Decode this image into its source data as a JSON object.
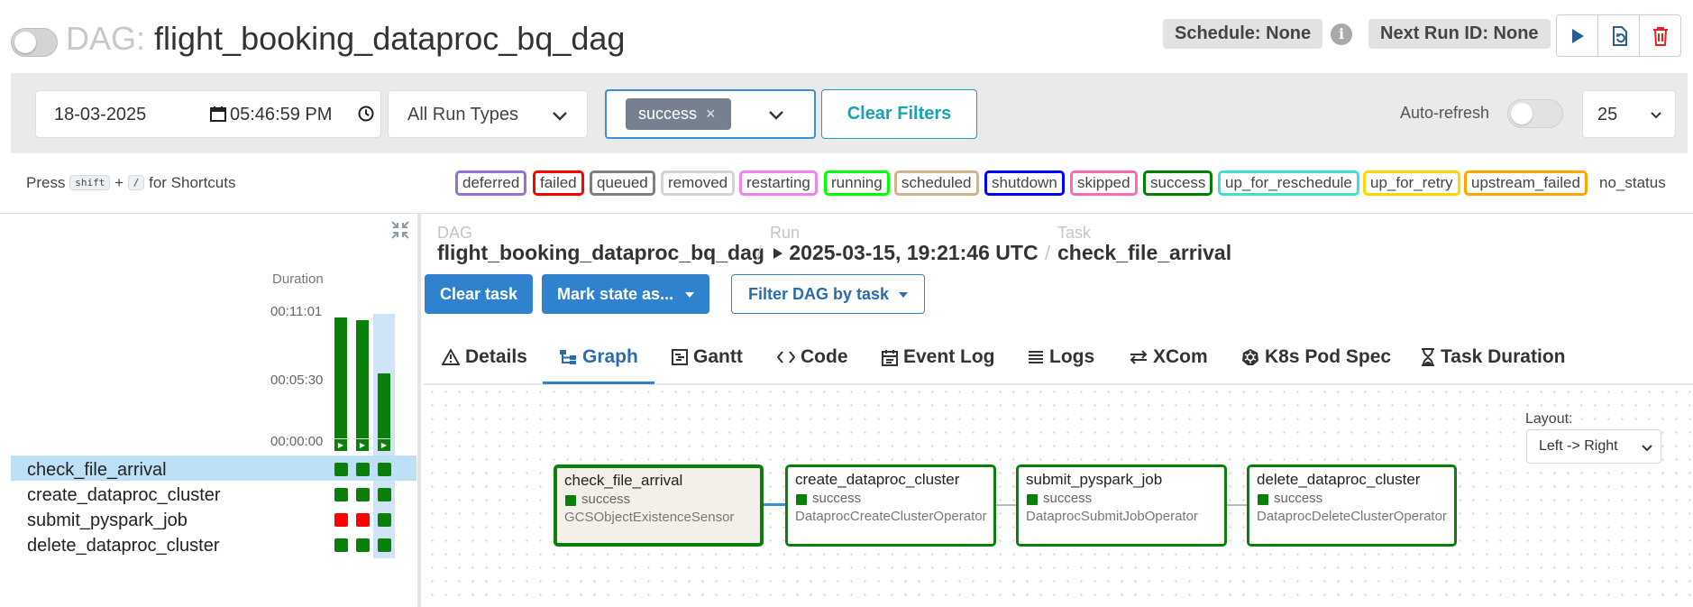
{
  "header": {
    "dag_prefix": "DAG:",
    "dag_id": "flight_booking_dataproc_bq_dag",
    "schedule": "Schedule: None",
    "info": "i",
    "next_run": "Next Run ID: None"
  },
  "filters": {
    "date": "18-03-2025",
    "time": "05:46:59 PM",
    "run_types": "All Run Types",
    "state_tag": "success",
    "state_tag_remove": "×",
    "clear_filters": "Clear Filters",
    "auto_refresh": "Auto-refresh",
    "limit": "25"
  },
  "shortcuts": {
    "press": "Press",
    "key1": "shift",
    "plus": "+",
    "key2": "/",
    "suffix": "for Shortcuts"
  },
  "legend": {
    "items": [
      {
        "label": "deferred",
        "color": "#9370db"
      },
      {
        "label": "failed",
        "color": "#ff0000"
      },
      {
        "label": "queued",
        "color": "#808080"
      },
      {
        "label": "removed",
        "color": "#d3d3d3"
      },
      {
        "label": "restarting",
        "color": "#ee82ee"
      },
      {
        "label": "running",
        "color": "#00ff00"
      },
      {
        "label": "scheduled",
        "color": "#d2b48c"
      },
      {
        "label": "shutdown",
        "color": "#0000ff"
      },
      {
        "label": "skipped",
        "color": "#ff69b4"
      },
      {
        "label": "success",
        "color": "#008000"
      },
      {
        "label": "up_for_reschedule",
        "color": "#40e0d0"
      },
      {
        "label": "up_for_retry",
        "color": "#ffd700"
      },
      {
        "label": "upstream_failed",
        "color": "#ffa500"
      }
    ],
    "no_status": "no_status"
  },
  "grid": {
    "duration_label": "Duration",
    "ticks": [
      "00:11:01",
      "00:05:30",
      "00:00:00"
    ],
    "run_durations_fraction": [
      0.97,
      0.95,
      0.52
    ],
    "tasks": [
      {
        "name": "check_file_arrival",
        "states": [
          "success",
          "success",
          "success"
        ]
      },
      {
        "name": "create_dataproc_cluster",
        "states": [
          "success",
          "success",
          "success"
        ]
      },
      {
        "name": "submit_pyspark_job",
        "states": [
          "failed",
          "failed",
          "success"
        ]
      },
      {
        "name": "delete_dataproc_cluster",
        "states": [
          "success",
          "success",
          "success"
        ]
      }
    ],
    "state_colors": {
      "success": "#0a800a",
      "failed": "#ff0000"
    }
  },
  "breadcrumb": {
    "dag_label": "DAG",
    "dag_value": "flight_booking_dataproc_bq_dag",
    "run_label": "Run",
    "run_value": "2025-03-15, 19:21:46 UTC",
    "task_label": "Task",
    "task_value": "check_file_arrival",
    "sep": "/"
  },
  "actions": {
    "clear_task": "Clear task",
    "mark_state": "Mark state as...",
    "filter_dag": "Filter DAG by task"
  },
  "tabs": [
    {
      "label": "Details",
      "icon": "warning-icon"
    },
    {
      "label": "Graph",
      "icon": "graph-icon"
    },
    {
      "label": "Gantt",
      "icon": "gantt-icon"
    },
    {
      "label": "Code",
      "icon": "code-icon"
    },
    {
      "label": "Event Log",
      "icon": "calendar-icon"
    },
    {
      "label": "Logs",
      "icon": "list-icon"
    },
    {
      "label": "XCom",
      "icon": "arrows-icon"
    },
    {
      "label": "K8s Pod Spec",
      "icon": "kubernetes-icon"
    },
    {
      "label": "Task Duration",
      "icon": "hourglass-icon"
    }
  ],
  "graph": {
    "layout_label": "Layout:",
    "layout_value": "Left -> Right",
    "nodes": [
      {
        "name": "check_file_arrival",
        "state": "success",
        "operator": "GCSObjectExistenceSensor"
      },
      {
        "name": "create_dataproc_cluster",
        "state": "success",
        "operator": "DataprocCreateClusterOperator"
      },
      {
        "name": "submit_pyspark_job",
        "state": "success",
        "operator": "DataprocSubmitJobOperator"
      },
      {
        "name": "delete_dataproc_cluster",
        "state": "success",
        "operator": "DataprocDeleteClusterOperator"
      }
    ]
  }
}
